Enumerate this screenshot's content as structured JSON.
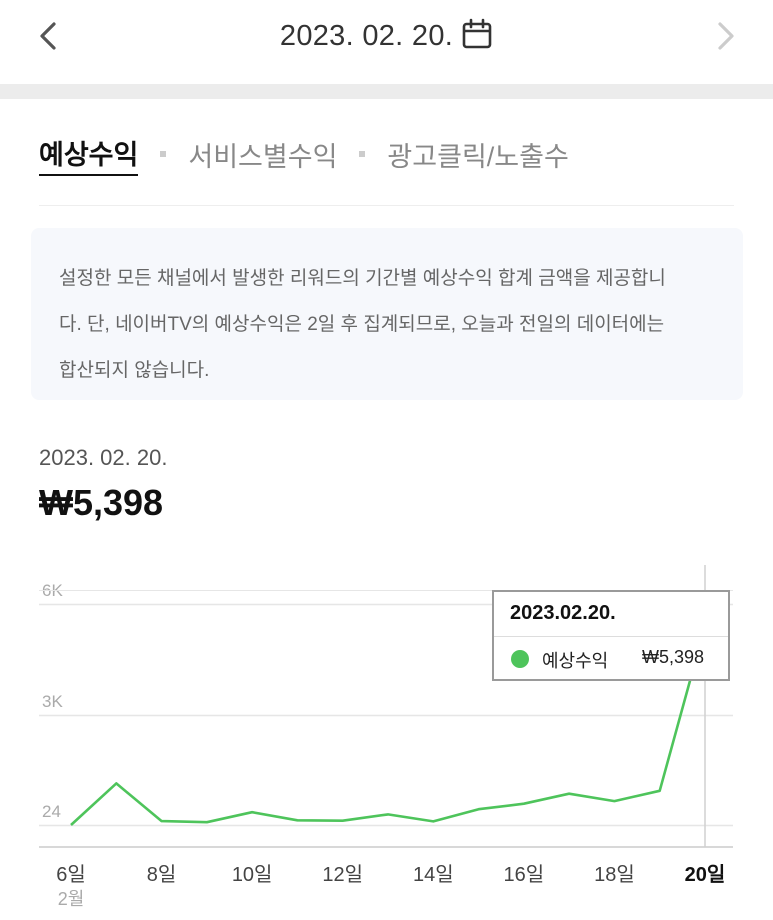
{
  "header": {
    "date": "2023. 02. 20.",
    "back_icon": "chevron-left-icon",
    "forward_icon": "chevron-right-icon",
    "calendar_icon": "calendar-icon"
  },
  "tabs": [
    {
      "label": "예상수익",
      "active": true
    },
    {
      "label": "서비스별수익",
      "active": false
    },
    {
      "label": "광고클릭/노출수",
      "active": false
    }
  ],
  "notice": {
    "line1": "설정한 모든 채널에서 발생한 리워드의 기간별 예상수익 합계 금액을 제공합니",
    "line2": "다. 단, 네이버TV의 예상수익은 2일 후 집계되므로, 오늘과 전일의 데이터에는",
    "line3": "합산되지 않습니다."
  },
  "summary": {
    "date": "2023. 02. 20.",
    "amount": "₩5,398"
  },
  "tooltip": {
    "date": "2023.02.20.",
    "label": "예상수익",
    "value": "₩5,398"
  },
  "colors": {
    "line": "#4ec45b",
    "grid": "#e6e6e6",
    "axis_text": "#aaaaaa"
  },
  "chart_data": {
    "type": "line",
    "x": [
      "6일",
      "7일",
      "8일",
      "9일",
      "10일",
      "11일",
      "12일",
      "13일",
      "14일",
      "15일",
      "16일",
      "17일",
      "18일",
      "19일",
      "20일"
    ],
    "x_tick_labels": [
      "6일",
      "8일",
      "10일",
      "12일",
      "14일",
      "16일",
      "18일",
      "20일"
    ],
    "x_sub_label": "2월",
    "y_tick_labels": [
      "24",
      "3K",
      "6K"
    ],
    "y_ticks": [
      24,
      3000,
      6000
    ],
    "ylim": [
      0,
      6500
    ],
    "series": [
      {
        "name": "예상수익",
        "values": [
          24,
          1150,
          130,
          100,
          370,
          150,
          140,
          310,
          120,
          450,
          600,
          870,
          670,
          950,
          5398
        ]
      }
    ],
    "highlight_index": 14,
    "grid": true
  }
}
